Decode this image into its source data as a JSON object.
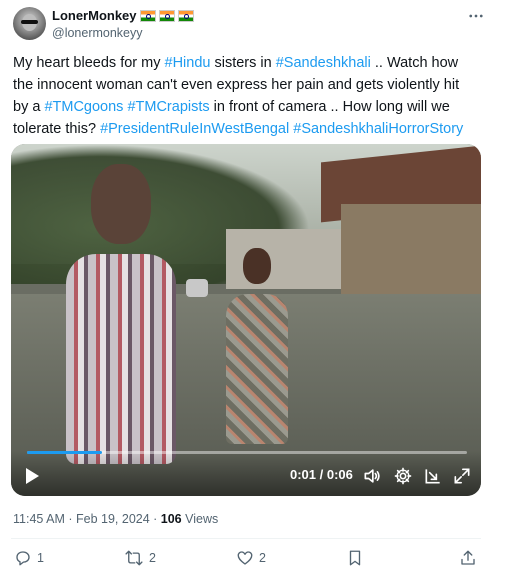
{
  "author": {
    "display_name": "LonerMonkey",
    "flags": [
      "indian-flag",
      "indian-flag",
      "indian-flag"
    ],
    "handle": "@lonermonkeyy"
  },
  "tweet": {
    "text_parts": [
      "My heart bleeds for my ",
      "#Hindu",
      " sisters in ",
      "#Sandeshkhali",
      " .. Watch how\nthe innocent woman can't even express her  pain and gets violently hit\nby a ",
      "#TMCgoons",
      " ",
      "#TMCrapists",
      " in front of camera .. How long will we\ntolerate this? ",
      "#PresidentRuleInWestBengal",
      " ",
      "#SandeshkhaliHorrorStory"
    ]
  },
  "video": {
    "current_time": "0:01",
    "duration": "0:06",
    "time_separator": " / ",
    "progress_fraction": 0.17,
    "accent_color": "#1d9bf0"
  },
  "meta": {
    "time": "11:45 AM",
    "date": "Feb 19, 2024",
    "separator": " · ",
    "views_count": "106",
    "views_label": " Views"
  },
  "actions": {
    "reply_count": "1",
    "repost_count": "2",
    "like_count": "2"
  },
  "colors": {
    "link": "#1d9bf0",
    "secondary_text": "#536471",
    "primary_text": "#0f1419"
  }
}
